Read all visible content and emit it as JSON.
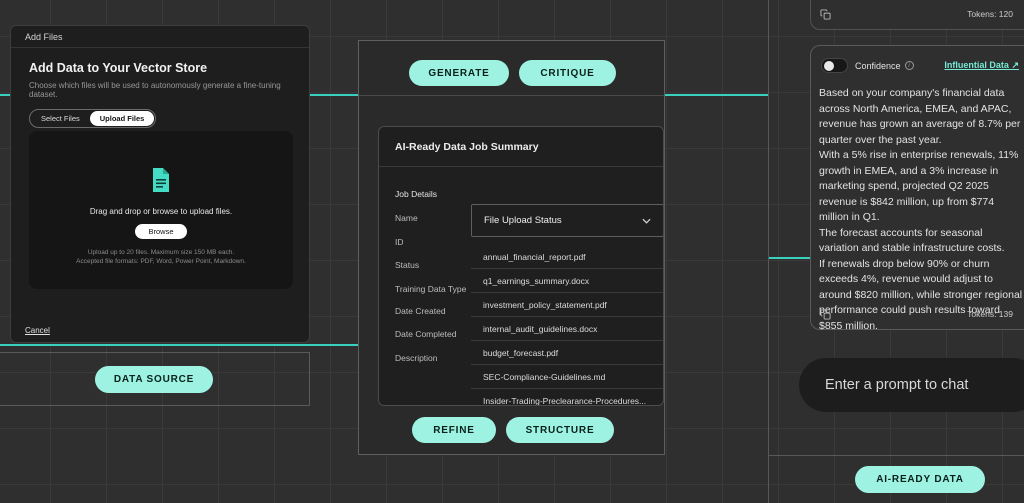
{
  "add_files_modal": {
    "header": "Add Files",
    "title": "Add Data to Your Vector Store",
    "subtitle": "Choose which files will be used to autonomously generate a fine-tuning dataset.",
    "tabs": {
      "select_label": "Select Files",
      "upload_label": "Upload Files"
    },
    "dropzone": {
      "instruction": "Drag and drop or browse to upload files.",
      "browse_label": "Browse",
      "note_line1": "Upload up to 20 files. Maximum size 150 MB each.",
      "note_line2": "Accepted file formats: PDF, Word, Power Point, Markdown."
    },
    "cancel_label": "Cancel"
  },
  "data_source": {
    "button_label": "DATA SOURCE"
  },
  "workflow": {
    "generate_label": "GENERATE",
    "critique_label": "CRITIQUE",
    "refine_label": "REFINE",
    "structure_label": "STRUCTURE",
    "job_summary": {
      "title": "AI-Ready Data Job Summary",
      "section_label": "Job Details",
      "fields": [
        "Name",
        "ID",
        "Status",
        "Training Data Type",
        "Date Created",
        "Date Completed",
        "Description"
      ],
      "status_dropdown": "File Upload Status",
      "files": [
        "annual_financial_report.pdf",
        "q1_earnings_summary.docx",
        "investment_policy_statement.pdf",
        "internal_audit_guidelines.docx",
        "budget_forecast.pdf",
        "SEC-Compliance-Guidelines.md",
        "Insider-Trading-Preclearance-Procedures..."
      ]
    }
  },
  "chat": {
    "top_tokens": "Tokens: 120",
    "response": {
      "toggle_label": "Confidence",
      "influential_link": "Influential Data",
      "link_arrow": "↗",
      "paragraphs": [
        "Based on your company's financial data across North America, EMEA, and APAC, revenue has grown an average of 8.7% per quarter over the past year.",
        "With a 5% rise in enterprise renewals, 11% growth in EMEA, and a 3% increase in marketing spend, projected Q2 2025 revenue is $842 million, up from $774 million in Q1.",
        "The forecast accounts for seasonal variation and stable infrastructure costs.",
        "If renewals drop below 90% or churn exceeds 4%, revenue would adjust to around $820 million, while stronger regional performance could push results toward $855 million."
      ],
      "tokens": "Tokens: 139"
    },
    "prompt_placeholder": "Enter a prompt to chat",
    "ai_ready_label": "AI-READY DATA"
  },
  "colors": {
    "accent_mint": "#9ef2e2",
    "connector_teal": "#38d1bd",
    "link_teal": "#74ead7"
  }
}
